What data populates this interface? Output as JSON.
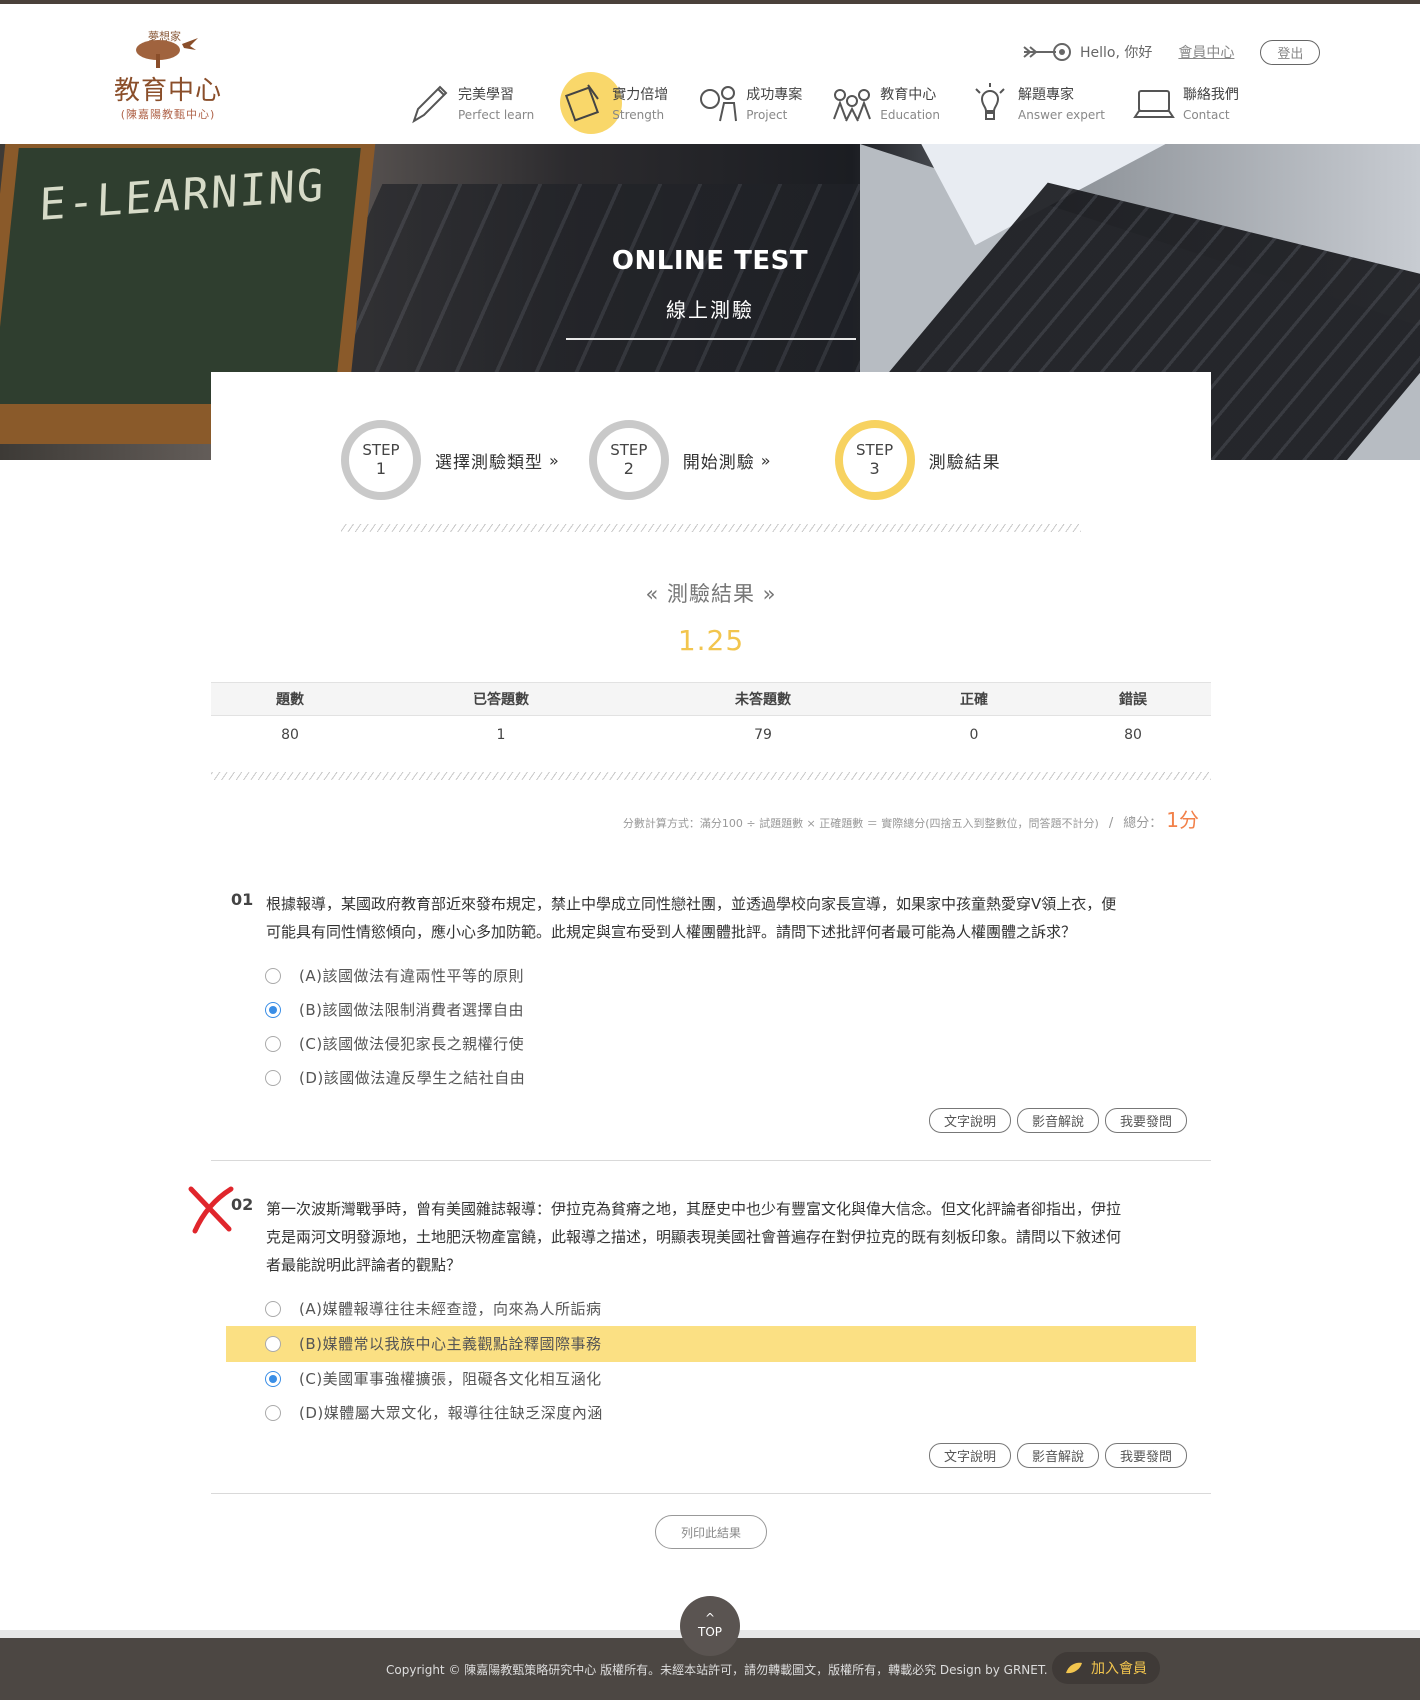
{
  "brand": {
    "dream": "夢想家",
    "name": "教育中心",
    "sub": "(陳嘉陽教甄中心)"
  },
  "userbar": {
    "hello": "Hello, 你好",
    "member": "會員中心",
    "logout": "登出"
  },
  "nav": [
    {
      "zh": "完美學習",
      "en": "Perfect learn",
      "icon": "pen-icon"
    },
    {
      "zh": "實力倍增",
      "en": "Strength",
      "icon": "notepad-icon"
    },
    {
      "zh": "成功專案",
      "en": "Project",
      "icon": "magnifier-person-icon"
    },
    {
      "zh": "教育中心",
      "en": "Education",
      "icon": "group-icon"
    },
    {
      "zh": "解題專家",
      "en": "Answer expert",
      "icon": "lightbulb-icon"
    },
    {
      "zh": "聯絡我們",
      "en": "Contact",
      "icon": "computer-icon"
    }
  ],
  "banner": {
    "board": "E-LEARNING",
    "title_en": "ONLINE TEST",
    "title_zh": "線上測驗"
  },
  "steps": [
    {
      "step": "STEP",
      "num": "1",
      "label": "選擇測驗類型",
      "chev": "»"
    },
    {
      "step": "STEP",
      "num": "2",
      "label": "開始測驗",
      "chev": "»"
    },
    {
      "step": "STEP",
      "num": "3",
      "label": "測驗結果",
      "chev": ""
    }
  ],
  "result": {
    "title": "« 測驗結果 »",
    "score": "1.25"
  },
  "stats": {
    "headers": [
      "題數",
      "已答題數",
      "未答題數",
      "正確",
      "錯誤"
    ],
    "values": [
      "80",
      "1",
      "79",
      "0",
      "80"
    ]
  },
  "formula": {
    "text": "分數計算方式：滿分100 ÷ 試題題數 × 正確題數 ＝ 實際總分(四捨五入到整數位，問答題不計分)",
    "sep": "/",
    "total_label": "總分：",
    "total_value": "1分"
  },
  "questions": [
    {
      "num": "01",
      "text": "根據報導，某國政府教育部近來發布規定，禁止中學成立同性戀社團，並透過學校向家長宣導，如果家中孩童熱愛穿V領上衣，便可能具有同性情慾傾向，應小心多加防範。此規定與宣布受到人權團體批評。請問下述批評何者最可能為人權團體之訴求？",
      "options": [
        "(A)該國做法有違兩性平等的原則",
        "(B)該國做法限制消費者選擇自由",
        "(C)該國做法侵犯家長之親權行使",
        "(D)該國做法違反學生之結社自由"
      ],
      "selected": 1
    },
    {
      "num": "02",
      "text": "第一次波斯灣戰爭時，曾有美國雜誌報導：伊拉克為貧瘠之地，其歷史中也少有豐富文化與偉大信念。但文化評論者卻指出，伊拉克是兩河文明發源地，土地肥沃物產富饒，此報導之描述，明顯表現美國社會普遍存在對伊拉克的既有刻板印象。請問以下敘述何者最能說明此評論者的觀點？",
      "options": [
        "(A)媒體報導往往未經查證，向來為人所詬病",
        "(B)媒體常以我族中心主義觀點詮釋國際事務",
        "(C)美國軍事強權擴張，阻礙各文化相互涵化",
        "(D)媒體屬大眾文化，報導往往缺乏深度內涵"
      ],
      "selected": 2,
      "correct": 1
    }
  ],
  "question_buttons": [
    "文字說明",
    "影音解說",
    "我要發問"
  ],
  "print_label": "列印此結果",
  "top_label": "TOP",
  "top_arrow": "^",
  "footer": {
    "copyright": "Copyright © 陳嘉陽教甄策略研究中心 版權所有。未經本站許可，請勿轉載圖文，版權所有，轉載必究 Design by GRNET.",
    "join": "加入會員"
  },
  "colors": {
    "accent_yellow": "#f7d260",
    "score_orange": "#f2814a",
    "footer_bg": "#4c4743",
    "wrong_red": "#e0262c"
  }
}
